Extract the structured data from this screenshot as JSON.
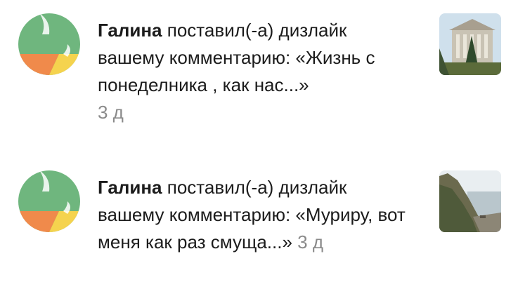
{
  "notifications": [
    {
      "user": "Галина",
      "action": "поставил(-а) дизлайк вашему комментарию:",
      "comment": "«Жизнь с понеделника , как нас...»",
      "time": "3 д",
      "avatar_icon": "leaf-avatar-icon",
      "thumb_icon": "building-photo-icon"
    },
    {
      "user": "Галина",
      "action": "поставил(-а) дизлайк вашему комментарию:",
      "comment": "«Муриру, вот меня как раз смуща...»",
      "time": "3 д",
      "avatar_icon": "leaf-avatar-icon",
      "thumb_icon": "coast-photo-icon"
    }
  ],
  "colors": {
    "avatar_green": "#6fb67e",
    "avatar_orange": "#f08a4b",
    "avatar_yellow": "#f5d34e",
    "text": "#1c1c1c",
    "time": "#8a8a8a"
  }
}
